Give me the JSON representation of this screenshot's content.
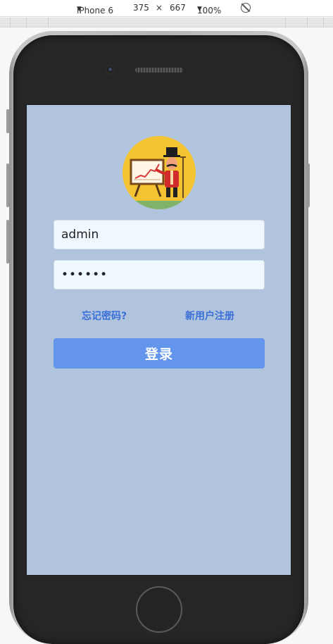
{
  "devtools": {
    "device": "iPhone 6",
    "width": "375",
    "times": "×",
    "height": "667",
    "zoom": "100%",
    "caret": "▼",
    "rotate_icon": "rotate-icon"
  },
  "login": {
    "username_value": "admin",
    "password_value": "••••••",
    "forgot_link": "忘记密码?",
    "register_link": "新用户注册",
    "submit_label": "登录"
  },
  "colors": {
    "screen_bg": "#b0c4de",
    "input_bg": "#f0f8ff",
    "link": "#3b6fd8",
    "button": "#6495ed",
    "avatar_bg": "#f4c331"
  }
}
